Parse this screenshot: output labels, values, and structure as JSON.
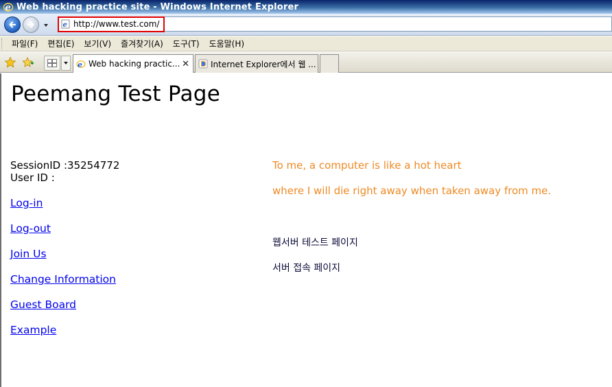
{
  "window": {
    "title": "Web hacking practice site - Windows Internet Explorer"
  },
  "address_bar": {
    "url": "http://www.test.com/"
  },
  "menu": {
    "items": [
      "파일(F)",
      "편집(E)",
      "보기(V)",
      "즐겨찾기(A)",
      "도구(T)",
      "도움말(H)"
    ]
  },
  "tabs": {
    "items": [
      {
        "label": "Web hacking practic...",
        "active": true
      },
      {
        "label": "Internet Explorer에서 웹 ...",
        "active": false
      }
    ]
  },
  "page": {
    "title": "Peemang Test Page",
    "session": "SessionID :35254772",
    "user_id": "User ID :",
    "links": [
      "Log-in",
      "Log-out",
      "Join Us",
      "Change Information",
      "Guest Board",
      "Example"
    ],
    "quote_line1": "To me, a computer is like a hot heart",
    "quote_line2": "where I will die right away when taken away from me.",
    "korean_line1": "웹서버 테스트 페이지",
    "korean_line2": "서버 접속 페이지"
  },
  "colors": {
    "quote": "#ee8a25",
    "link": "#0000ee",
    "address_highlight": "#e10000"
  },
  "icons": {
    "title_logo": "ie-logo-icon",
    "back": "back-arrow-icon",
    "forward": "forward-arrow-icon",
    "favorites": "favorites-star-icon",
    "add_favorites": "add-favorites-icon",
    "quick_tabs": "quick-tabs-icon",
    "tab_close": "close-icon"
  }
}
